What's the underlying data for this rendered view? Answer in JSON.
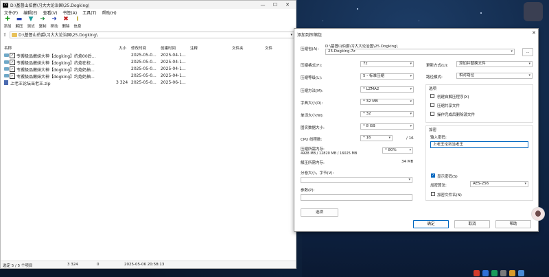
{
  "filemanager": {
    "title": "D:\\基督山伯爵\\习大大论治国\\25.Dogking\\",
    "menu": [
      "文件(F)",
      "编辑(E)",
      "查看(V)",
      "书签(A)",
      "工具(T)",
      "帮助(H)"
    ],
    "toolbar": [
      {
        "label": "添加",
        "icon": "add-icon",
        "color": "#1a9a1a",
        "glyph": "✚"
      },
      {
        "label": "解压",
        "icon": "extract-icon",
        "color": "#2340b5",
        "glyph": "▬"
      },
      {
        "label": "测试",
        "icon": "test-icon",
        "color": "#1e9e9e",
        "glyph": "▼"
      },
      {
        "label": "复制",
        "icon": "copy-icon",
        "color": "#1a8a3a",
        "glyph": "➜"
      },
      {
        "label": "移动",
        "icon": "move-icon",
        "color": "#2340b5",
        "glyph": "➜"
      },
      {
        "label": "删除",
        "icon": "delete-icon",
        "color": "#c01a1a",
        "glyph": "✖"
      },
      {
        "label": "信息",
        "icon": "info-icon",
        "color": "#b8a21a",
        "glyph": "i"
      }
    ],
    "path": "D:\\基督山伯爵\\习大大论治国\\25.Dogking\\",
    "columns": [
      "名称",
      "大小",
      "修改时间",
      "创建时间",
      "注释",
      "文件夹",
      "文件"
    ],
    "rows": [
      {
        "name": "专搬极品嫩妹大神【dogking】约炮00后...",
        "size": "",
        "modified": "2025-05-0...",
        "created": "2025-04-1...",
        "type": "folder",
        "checked": "✓"
      },
      {
        "name": "专搬极品嫩妹大神【dogking】约炮在校...",
        "size": "",
        "modified": "2025-05-0...",
        "created": "2025-04-1...",
        "type": "folder",
        "checked": "✓"
      },
      {
        "name": "专搬极品嫩妹大神【dogking】约炮奶抽...",
        "size": "",
        "modified": "2025-05-0...",
        "created": "2025-04-1...",
        "type": "folder",
        "checked": "✓"
      },
      {
        "name": "专搬极品嫩妹大神【dogking】约炮奶抽...",
        "size": "",
        "modified": "2025-05-0...",
        "created": "2025-04-1...",
        "type": "folder",
        "checked": "✓"
      },
      {
        "name": "上老王论坛当老王.zip",
        "size": "3 324",
        "modified": "2025-05-0...",
        "created": "2025-06-1...",
        "type": "zip",
        "checked": ""
      }
    ],
    "status": {
      "selected": "选定 5 / 5 个项目",
      "size": "3 324",
      "count": "0",
      "datetime": "2025-05-06 20:58:13"
    }
  },
  "dialog": {
    "title": "添加到压缩包",
    "archive_label": "压缩包(A):",
    "archive_dir": "D:\\基督山伯爵\\习大大论治国\\25.Dogking\\",
    "archive_name": "25.Dogking.7z",
    "browse": "...",
    "format_label": "压缩格式(F):",
    "format": "7z",
    "level_label": "压缩等级(L):",
    "level": "5 - 标准压缩",
    "method_label": "压缩方法(M):",
    "method": "* LZMA2",
    "dict_label": "字典大小(D):",
    "dict": "* 32 MB",
    "word_label": "单词大小(W):",
    "word": "* 32",
    "solid_label": "固实数据大小:",
    "solid": "* 8 GB",
    "cpu_label": "CPU 线程数:",
    "cpu": "* 16",
    "cpu_total": "/ 16",
    "mem_label": "压缩所需内存:",
    "mem_value": "4928 MB / 12820 MB / 16025 MB",
    "mem_pct": "* 80%",
    "unmem_label": "解压所需内存:",
    "unmem_value": "34 MB",
    "split_label": "分卷大小，字节(V):",
    "params_label": "参数(P):",
    "options_btn": "选项",
    "update_label": "更新方式(U):",
    "update": "添加并替换文件",
    "pathmode_label": "路径模式:",
    "pathmode": "相对路径",
    "options_title": "选项",
    "opt_sfx": "创建自解压程序(X)",
    "opt_shared": "压缩共享文件",
    "opt_delete": "操作完成后删除源文件",
    "enc_title": "加密",
    "pwd_label": "输入密码:",
    "pwd_value": "上老王论坛当老王",
    "show_pwd": "显示密码(S)",
    "enc_method_label": "加密算法:",
    "enc_method": "AES-256",
    "enc_names": "加密文件名(N)",
    "ok": "确定",
    "cancel": "取消",
    "help": "帮助"
  }
}
